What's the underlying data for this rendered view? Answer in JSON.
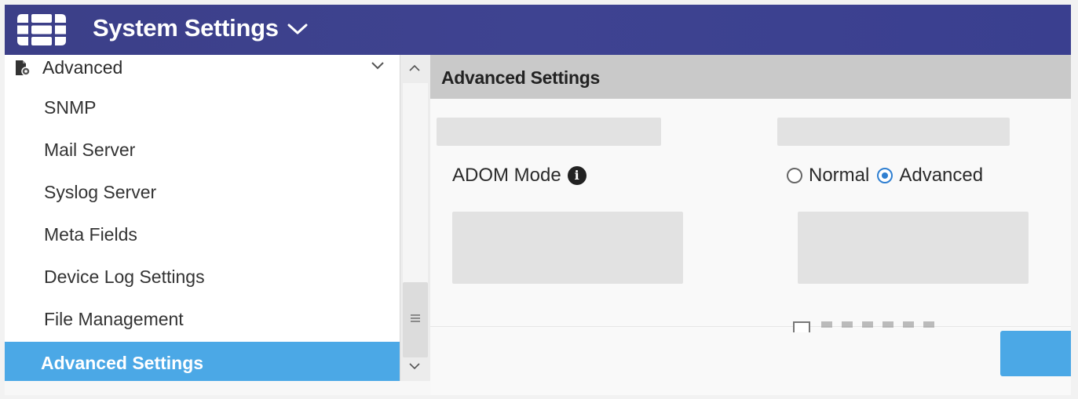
{
  "header": {
    "title": "System Settings",
    "logo_icon": "fortinet-logo-icon",
    "dropdown_icon": "chevron-down-icon"
  },
  "sidebar": {
    "parent": {
      "label": "Advanced",
      "icon": "gear-document-icon",
      "expand_icon": "chevron-down-icon"
    },
    "items": [
      {
        "label": "SNMP",
        "active": false
      },
      {
        "label": "Mail Server",
        "active": false
      },
      {
        "label": "Syslog Server",
        "active": false
      },
      {
        "label": "Meta Fields",
        "active": false
      },
      {
        "label": "Device Log Settings",
        "active": false
      },
      {
        "label": "File Management",
        "active": false
      },
      {
        "label": "Advanced Settings",
        "active": true
      }
    ]
  },
  "main": {
    "section_title": "Advanced Settings",
    "adom_mode": {
      "label": "ADOM Mode",
      "info_icon": "info-icon",
      "options": [
        "Normal",
        "Advanced"
      ],
      "selected": "Advanced"
    }
  },
  "colors": {
    "header_bg": "#3c3f88",
    "active_item_bg": "#4ba8e6",
    "section_header_bg": "#c9c9c9",
    "radio_accent": "#2f7fd1"
  }
}
